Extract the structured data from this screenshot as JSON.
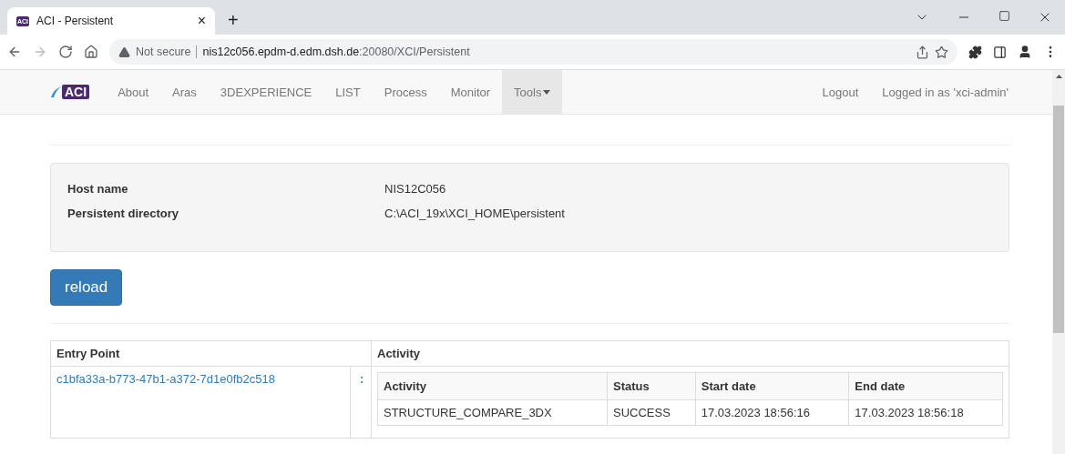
{
  "browser": {
    "tab_title": "ACI - Persistent",
    "tab_close": "×",
    "new_tab": "+",
    "security": "Not secure",
    "url_host": "nis12c056.epdm-d.edm.dsh.de",
    "url_path": ":20080/XCI/Persistent"
  },
  "navbar": {
    "favicon": "ACI",
    "brand": "ACI",
    "items": [
      {
        "label": "About",
        "selected": false,
        "dropdown": false
      },
      {
        "label": "Aras",
        "selected": false,
        "dropdown": false
      },
      {
        "label": "3DEXPERIENCE",
        "selected": false,
        "dropdown": false
      },
      {
        "label": "LIST",
        "selected": false,
        "dropdown": false
      },
      {
        "label": "Process",
        "selected": false,
        "dropdown": false
      },
      {
        "label": "Monitor",
        "selected": false,
        "dropdown": false
      },
      {
        "label": "Tools",
        "selected": true,
        "dropdown": true
      }
    ],
    "logout": "Logout",
    "user": "Logged in as 'xci-admin'"
  },
  "info": [
    {
      "label": "Host name",
      "value": "NIS12C056"
    },
    {
      "label": "Persistent directory",
      "value": "C:\\ACI_19x\\XCI_HOME\\persistent"
    }
  ],
  "reload_button": "reload",
  "table": {
    "columns": [
      "Entry Point",
      "Activity"
    ],
    "rows": [
      {
        "entry_point": "c1bfa33a-b773-47b1-a372-7d1e0fb2c518",
        "marker": ":",
        "activity": {
          "columns": [
            "Activity",
            "Status",
            "Start date",
            "End date"
          ],
          "rows": [
            [
              "STRUCTURE_COMPARE_3DX",
              "SUCCESS",
              "17.03.2023 18:56:16",
              "17.03.2023 18:56:18"
            ]
          ]
        }
      }
    ]
  }
}
